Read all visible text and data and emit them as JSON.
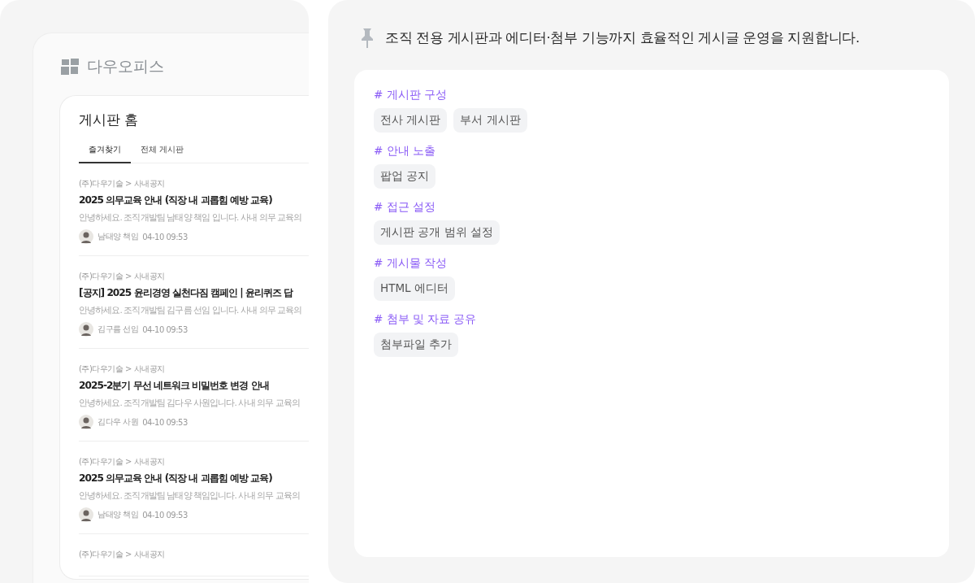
{
  "app": {
    "logo_text": "다우오피스"
  },
  "board": {
    "title": "게시판 홈",
    "tabs": [
      {
        "label": "즐겨찾기",
        "selected": true
      },
      {
        "label": "전체 게시판",
        "selected": false
      }
    ],
    "posts": [
      {
        "category": "(주)다우기술 > 사내공지",
        "title": "2025 의무교육 안내 (직장 내 괴롭힘 예방 교육)",
        "excerpt": "안녕하세요. 조직개발팀 남태양 책임 입니다. 사내 의무 교육의",
        "author": "남태양 책임",
        "time": "04-10 09:53"
      },
      {
        "category": "(주)다우기술 > 사내공지",
        "title": "[공지] 2025 윤리경영 실천다짐 캠페인 | 윤리퀴즈 답",
        "excerpt": "안녕하세요. 조직개발팀 김구름 선임 입니다. 사내 의무 교육의",
        "author": "김구름 선임",
        "time": "04-10 09:53"
      },
      {
        "category": "(주)다우기술 > 사내공지",
        "title": "2025-2분기 무선 네트워크 비밀번호 변경 안내",
        "excerpt": "안녕하세요. 조직개발팀 김다우 사원입니다. 사내 의무 교육의",
        "author": "김다우 사원",
        "time": "04-10 09:53"
      },
      {
        "category": "(주)다우기술 > 사내공지",
        "title": "2025 의무교육 안내 (직장 내 괴롭힘 예방 교육)",
        "excerpt": "안녕하세요. 조직개발팀 남태양 책임입니다. 사내 의무 교육의",
        "author": "남태양 책임",
        "time": "04-10 09:53"
      },
      {
        "category": "(주)다우기술 > 사내공지"
      }
    ]
  },
  "feature_panel": {
    "headline": "조직 전용 게시판과 에디터·첨부 기능까지 효율적인 게시글 운영을 지원합니다.",
    "sections": [
      {
        "heading": "# 게시판 구성",
        "chips": [
          "전사 게시판",
          "부서 게시판"
        ]
      },
      {
        "heading": "# 안내 노출",
        "chips": [
          "팝업 공지"
        ]
      },
      {
        "heading": "# 접근 설정",
        "chips": [
          "게시판 공개 범위 설정"
        ]
      },
      {
        "heading": "# 게시물 작성",
        "chips": [
          "HTML 에디터"
        ]
      },
      {
        "heading": "# 첨부 및 자료 공유",
        "chips": [
          "첨부파일 추가"
        ]
      }
    ]
  }
}
